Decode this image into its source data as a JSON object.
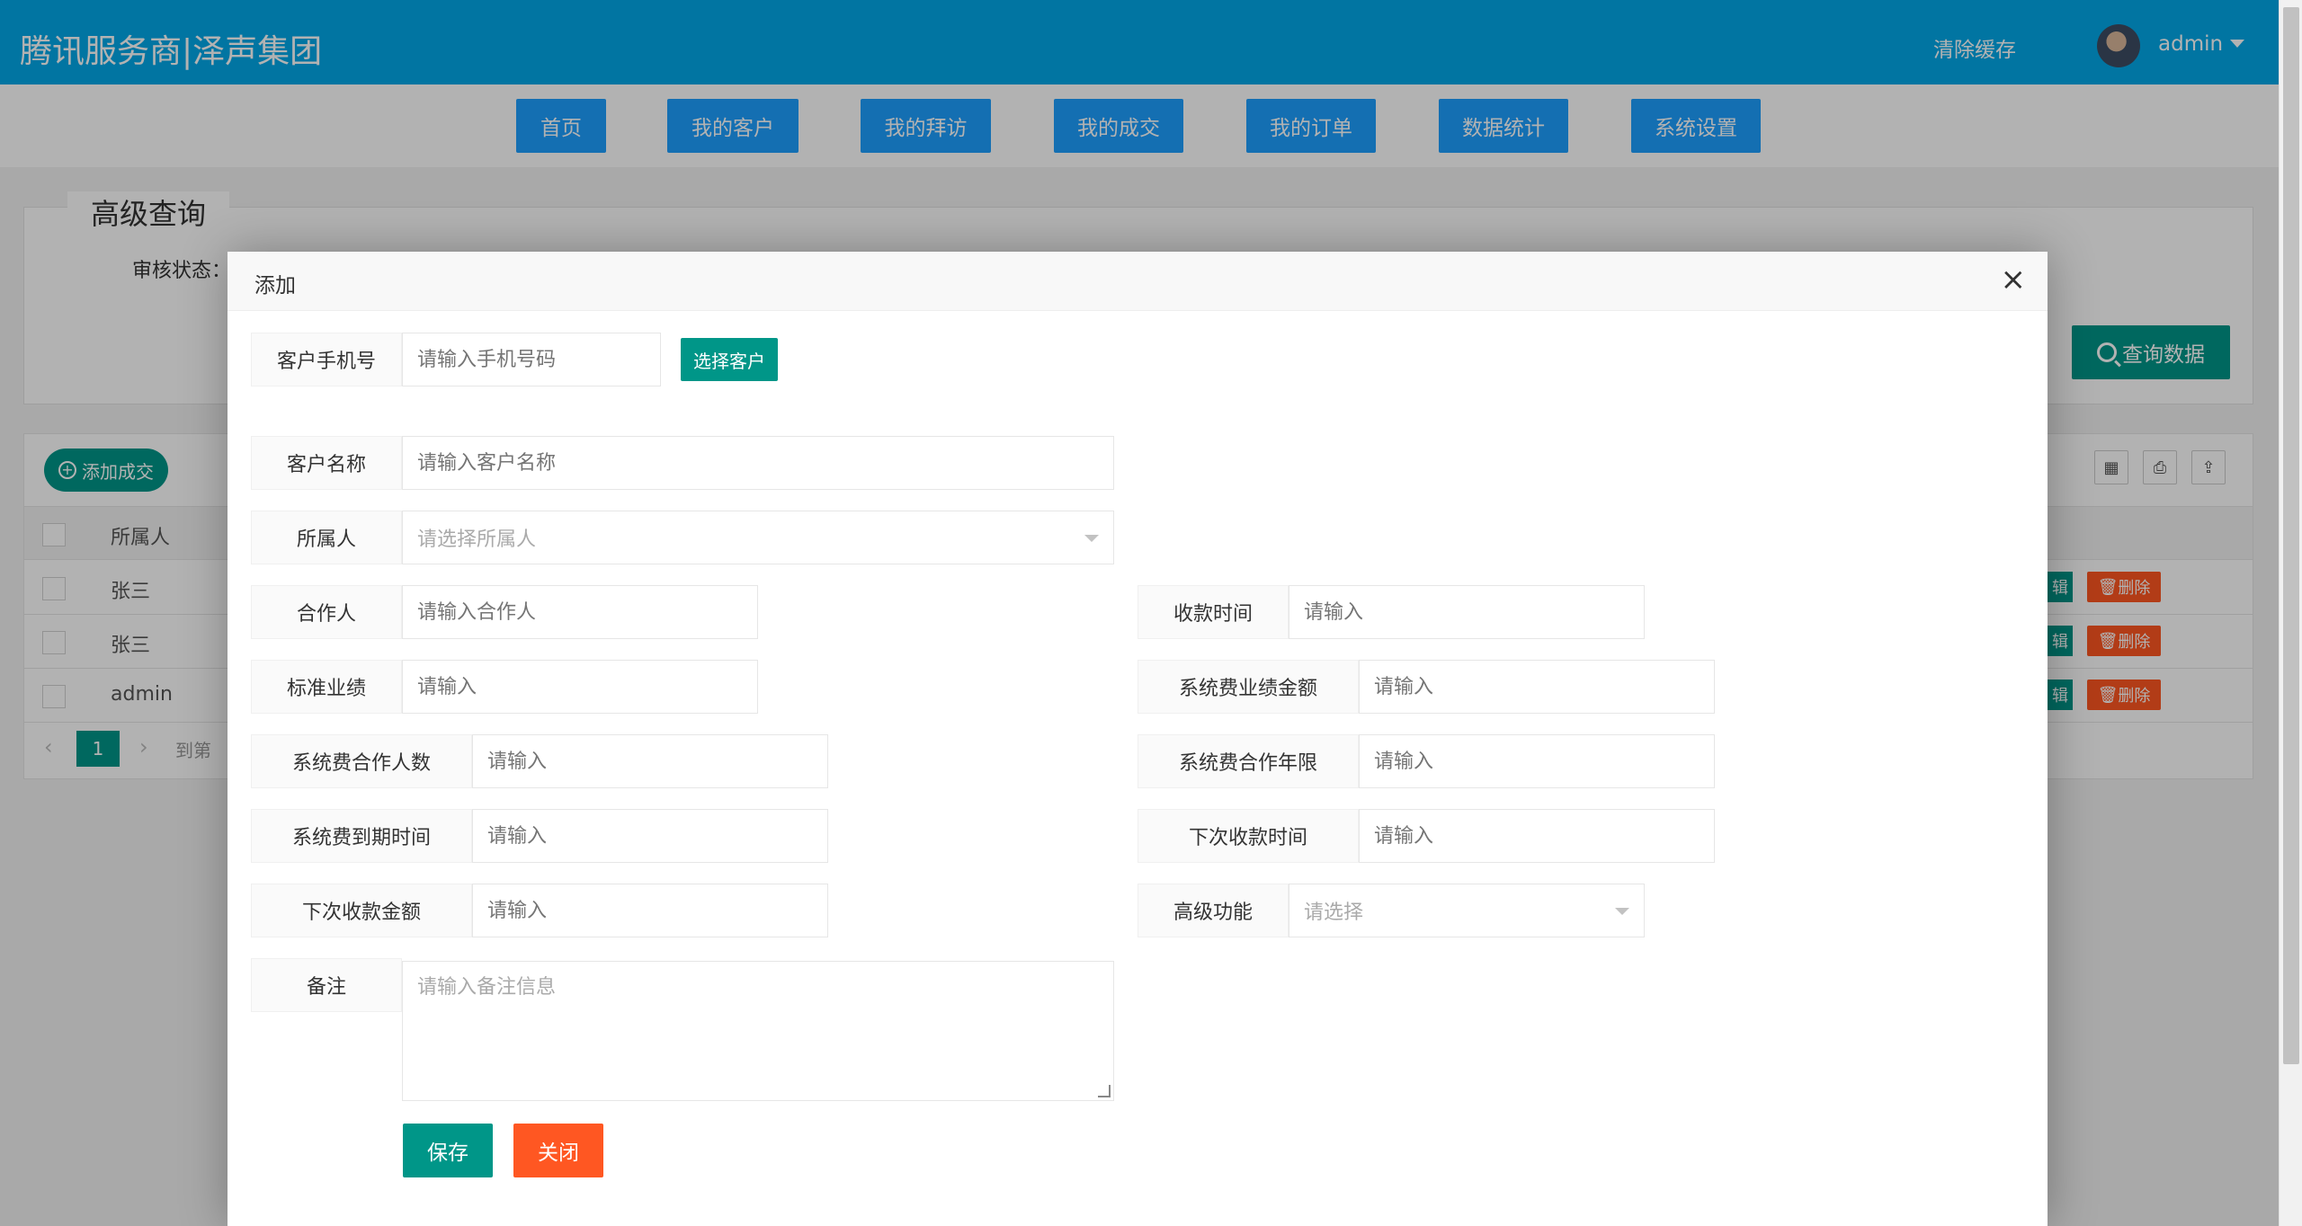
{
  "header": {
    "brand": "腾讯服务商|泽声集团",
    "clear_cache": "清除缓存",
    "user": "admin"
  },
  "nav": {
    "items": [
      {
        "label": "首页"
      },
      {
        "label": "我的客户"
      },
      {
        "label": "我的拜访"
      },
      {
        "label": "我的成交"
      },
      {
        "label": "我的订单"
      },
      {
        "label": "数据统计"
      },
      {
        "label": "系统设置"
      }
    ]
  },
  "search": {
    "legend": "高级查询",
    "audit_label": "审核状态：",
    "query_button": "查询数据"
  },
  "table": {
    "add_button": "添加成交",
    "owner_header": "所属人",
    "rows": [
      {
        "owner": "张三",
        "edit": "辑",
        "delete": "删除"
      },
      {
        "owner": "张三",
        "edit": "辑",
        "delete": "删除"
      },
      {
        "owner": "admin",
        "edit": "辑",
        "delete": "删除"
      }
    ],
    "pager": {
      "current": "1",
      "goto": "到第"
    }
  },
  "modal": {
    "title": "添加",
    "close": "×",
    "fields": {
      "phone": {
        "label": "客户手机号",
        "placeholder": "请输入手机号码"
      },
      "choose_customer": "选择客户",
      "customer_name": {
        "label": "客户名称",
        "placeholder": "请输入客户名称"
      },
      "owner": {
        "label": "所属人",
        "placeholder": "请选择所属人"
      },
      "partner": {
        "label": "合作人",
        "placeholder": "请输入合作人"
      },
      "pay_time": {
        "label": "收款时间",
        "placeholder": "请输入"
      },
      "std_perf": {
        "label": "标准业绩",
        "placeholder": "请输入"
      },
      "sys_fee_amount": {
        "label": "系统费业绩金额",
        "placeholder": "请输入"
      },
      "sys_fee_partners": {
        "label": "系统费合作人数",
        "placeholder": "请输入"
      },
      "sys_fee_years": {
        "label": "系统费合作年限",
        "placeholder": "请输入"
      },
      "sys_fee_expire": {
        "label": "系统费到期时间",
        "placeholder": "请输入"
      },
      "next_pay_time": {
        "label": "下次收款时间",
        "placeholder": "请输入"
      },
      "next_pay_amount": {
        "label": "下次收款金额",
        "placeholder": "请输入"
      },
      "advanced": {
        "label": "高级功能",
        "placeholder": "请选择"
      },
      "remark": {
        "label": "备注",
        "placeholder": "请输入备注信息"
      }
    },
    "save": "保存",
    "close_button": "关闭"
  },
  "colors": {
    "header_bg": "#02a8e8",
    "nav_button": "#1e9fff",
    "primary_green": "#009688",
    "danger_orange": "#ff5722"
  }
}
